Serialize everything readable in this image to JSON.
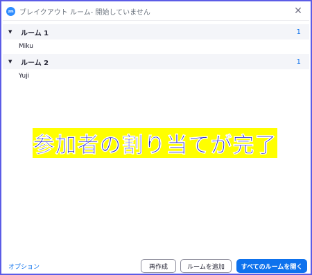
{
  "window": {
    "app_icon": "zoom-logo-icon",
    "app_icon_text": "zm",
    "title": "ブレイクアウト ルーム- 開始していません",
    "close_glyph": "✕"
  },
  "rooms": [
    {
      "caret": "▼",
      "name": "ルーム 1",
      "count": "1",
      "participants": [
        "Miku"
      ]
    },
    {
      "caret": "▼",
      "name": "ルーム 2",
      "count": "1",
      "participants": [
        "Yuji"
      ]
    }
  ],
  "overlay_banner": {
    "text": "参加者の割り当てが完了",
    "background": "#ffff00",
    "text_color": "#1a1ad6"
  },
  "footer": {
    "options_label": "オプション",
    "recreate_label": "再作成",
    "add_room_label": "ルームを追加",
    "open_all_label": "すべてのルームを開く"
  },
  "colors": {
    "accent": "#0e72ed",
    "window_border": "#5b5ce6",
    "room_header_bg": "#f4f5f9"
  }
}
